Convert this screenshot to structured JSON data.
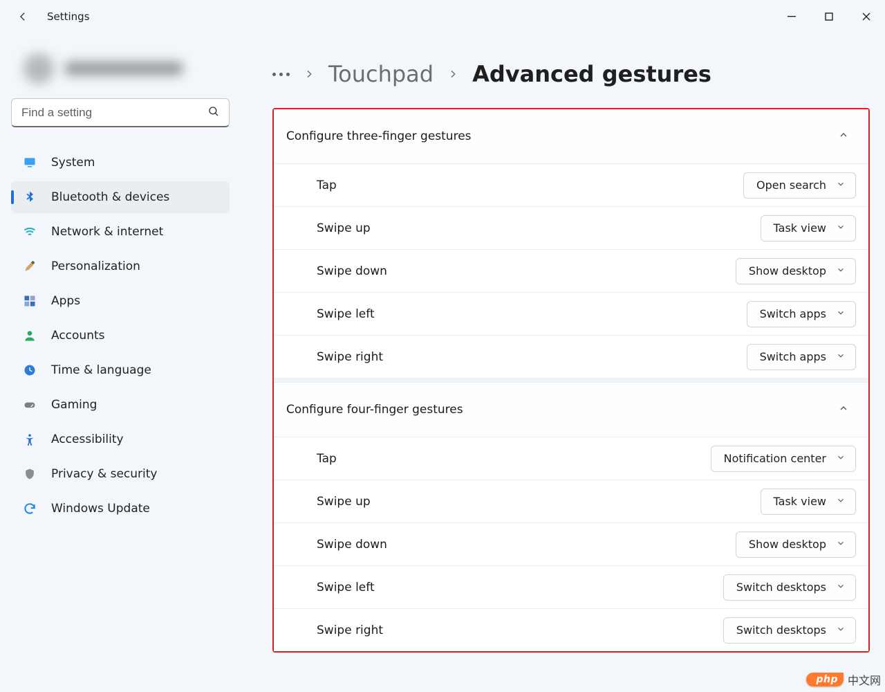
{
  "titlebar": {
    "app_title": "Settings"
  },
  "search": {
    "placeholder": "Find a setting"
  },
  "nav": {
    "items": [
      {
        "label": "System",
        "icon": "monitor-icon",
        "color": "#1e88e5"
      },
      {
        "label": "Bluetooth & devices",
        "icon": "bluetooth-icon",
        "color": "#1e6fd9",
        "active": true
      },
      {
        "label": "Network & internet",
        "icon": "wifi-icon",
        "color": "#22b2c6"
      },
      {
        "label": "Personalization",
        "icon": "paintbrush-icon",
        "color": "#c9823e"
      },
      {
        "label": "Apps",
        "icon": "apps-icon",
        "color": "#3a6fb7"
      },
      {
        "label": "Accounts",
        "icon": "person-icon",
        "color": "#2aa866"
      },
      {
        "label": "Time & language",
        "icon": "globe-clock-icon",
        "color": "#2f7bd8"
      },
      {
        "label": "Gaming",
        "icon": "gamepad-icon",
        "color": "#7d7d7d"
      },
      {
        "label": "Accessibility",
        "icon": "accessibility-icon",
        "color": "#1e6fd9"
      },
      {
        "label": "Privacy & security",
        "icon": "shield-icon",
        "color": "#8a8d92"
      },
      {
        "label": "Windows Update",
        "icon": "update-icon",
        "color": "#1e88e5"
      }
    ]
  },
  "breadcrumb": {
    "parent": "Touchpad",
    "current": "Advanced gestures"
  },
  "groups": [
    {
      "title": "Configure three-finger gestures",
      "rows": [
        {
          "label": "Tap",
          "value": "Open search"
        },
        {
          "label": "Swipe up",
          "value": "Task view"
        },
        {
          "label": "Swipe down",
          "value": "Show desktop"
        },
        {
          "label": "Swipe left",
          "value": "Switch apps"
        },
        {
          "label": "Swipe right",
          "value": "Switch apps"
        }
      ]
    },
    {
      "title": "Configure four-finger gestures",
      "rows": [
        {
          "label": "Tap",
          "value": "Notification center"
        },
        {
          "label": "Swipe up",
          "value": "Task view"
        },
        {
          "label": "Swipe down",
          "value": "Show desktop"
        },
        {
          "label": "Swipe left",
          "value": "Switch desktops"
        },
        {
          "label": "Swipe right",
          "value": "Switch desktops"
        }
      ]
    }
  ],
  "watermark": {
    "badge": "php",
    "text": "中文网"
  }
}
